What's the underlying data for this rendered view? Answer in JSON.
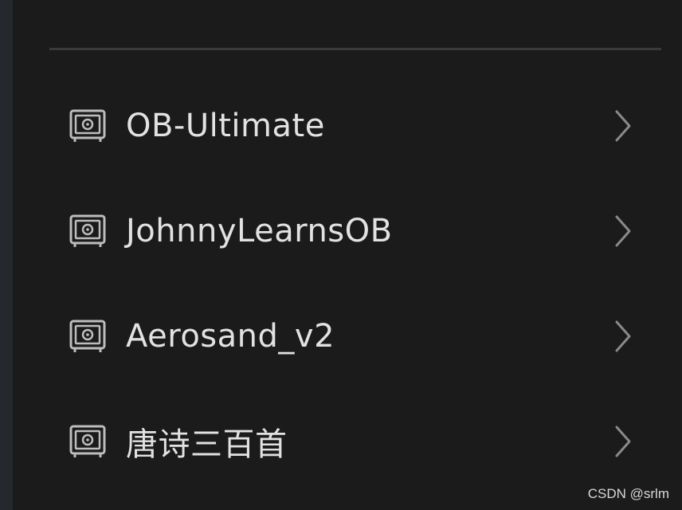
{
  "vaults": [
    {
      "name": "OB-Ultimate",
      "icon": "vault-icon"
    },
    {
      "name": "JohnnyLearnsOB",
      "icon": "vault-icon"
    },
    {
      "name": "Aerosand_v2",
      "icon": "vault-icon"
    },
    {
      "name": "唐诗三百首",
      "icon": "vault-icon"
    }
  ],
  "watermark": "CSDN @srlm",
  "colors": {
    "background": "#1b1b1b",
    "text": "#e2e2e2",
    "icon": "#bdbdbd",
    "divider": "#3a3a3a"
  }
}
